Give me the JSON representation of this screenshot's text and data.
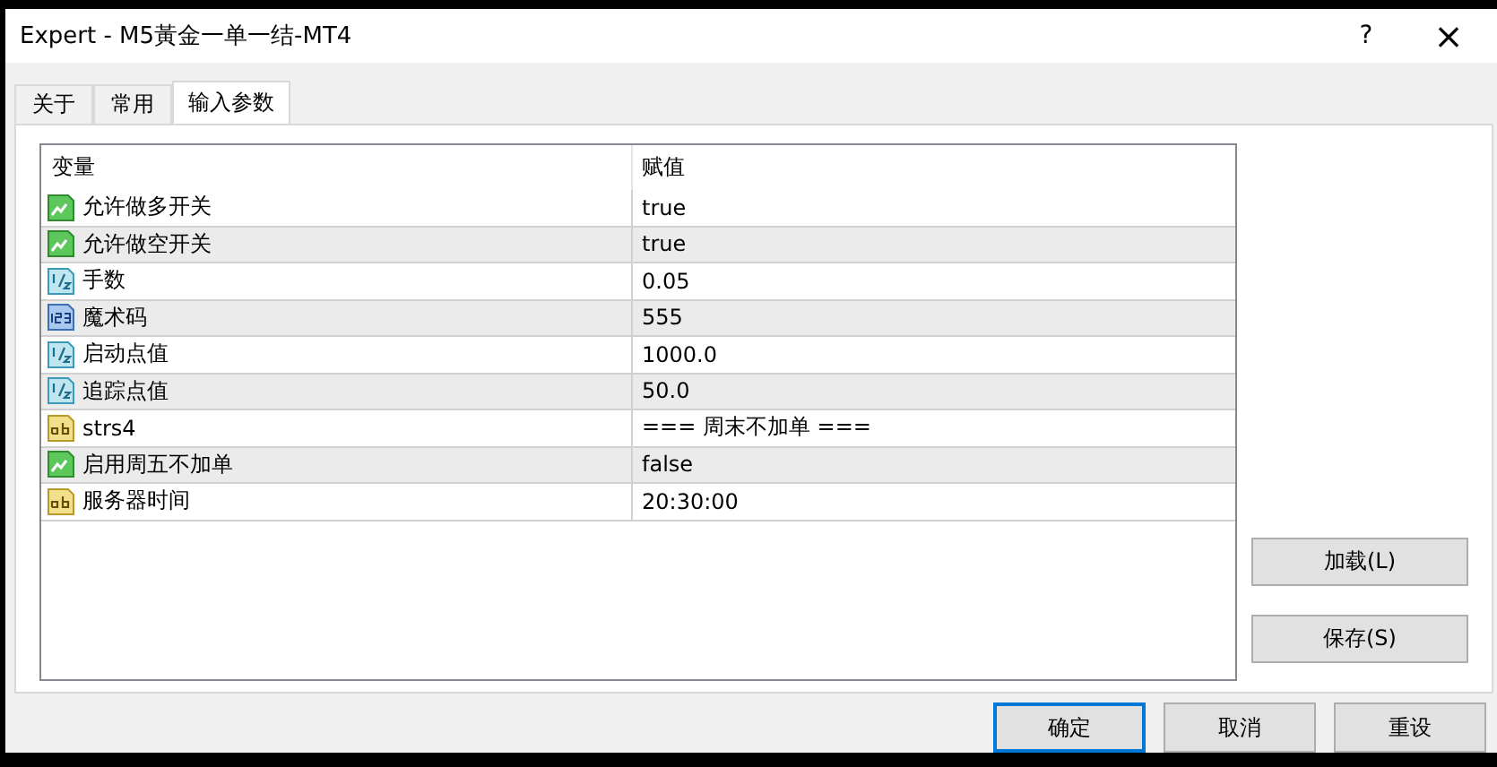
{
  "window": {
    "title": "Expert - M5黃金一单一结-MT4",
    "help": "?",
    "close": "×"
  },
  "tabs": [
    {
      "label": "关于",
      "selected": false
    },
    {
      "label": "常用",
      "selected": false
    },
    {
      "label": "输入参数",
      "selected": true
    }
  ],
  "table": {
    "columns": [
      "变量",
      "赋值"
    ],
    "rows": [
      {
        "kind": "bool",
        "name": "允许做多开关",
        "value": "true"
      },
      {
        "kind": "bool",
        "name": "允许做空开关",
        "value": "true"
      },
      {
        "kind": "double",
        "name": "手数",
        "value": "0.05"
      },
      {
        "kind": "int",
        "name": "魔术码",
        "value": "555"
      },
      {
        "kind": "double",
        "name": "启动点值",
        "value": "1000.0"
      },
      {
        "kind": "double",
        "name": "追踪点值",
        "value": "50.0"
      },
      {
        "kind": "string",
        "name": "strs4",
        "value": "=== 周末不加单 ==="
      },
      {
        "kind": "bool",
        "name": "启用周五不加单",
        "value": "false"
      },
      {
        "kind": "string",
        "name": "服务器时间",
        "value": "20:30:00"
      }
    ]
  },
  "side_buttons": [
    "加载(L)",
    "保存(S)"
  ],
  "buttons": [
    {
      "label": "确定",
      "default": true
    },
    {
      "label": "取消",
      "default": false
    },
    {
      "label": "重设",
      "default": false
    }
  ]
}
